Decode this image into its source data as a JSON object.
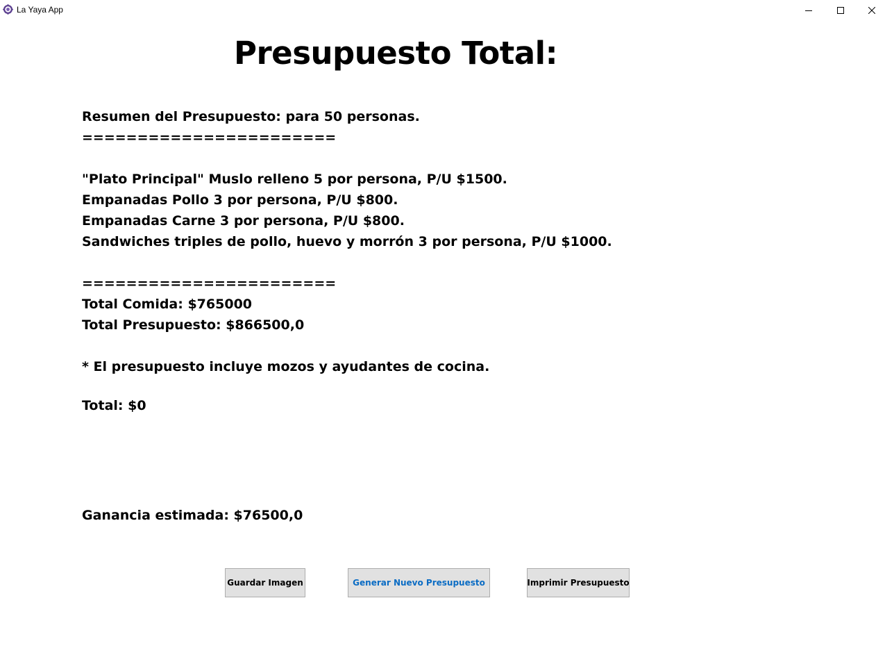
{
  "window": {
    "title": "La Yaya App",
    "app_icon": "gear-logo-icon",
    "controls": [
      "minimize-icon",
      "maximize-icon",
      "close-icon"
    ]
  },
  "page": {
    "title": "Presupuesto Total:"
  },
  "summary": {
    "header": "Resumen del Presupuesto: para 50 personas.",
    "separator": "=======================",
    "items": [
      "\"Plato Principal\" Muslo relleno 5 por persona, P/U $1500.",
      "Empanadas Pollo 3 por persona, P/U $800.",
      "Empanadas Carne 3 por persona, P/U $800.",
      "Sandwiches triples de pollo, huevo y morrón 3 por persona, P/U $1000."
    ],
    "total_comida": "Total Comida: $765000",
    "total_presupuesto": "Total Presupuesto: $866500,0",
    "note": "* El presupuesto incluye mozos y ayudantes de cocina.",
    "total": "Total: $0",
    "ganancia": "Ganancia estimada: $76500,0"
  },
  "buttons": {
    "save": "Guardar Imagen",
    "new": "Generar Nuevo Presupuesto",
    "print": "Imprimir Presupuesto"
  },
  "colors": {
    "accent_button_text": "#0a6cc4",
    "button_bg": "#e1e1e1",
    "button_border": "#adadad"
  }
}
